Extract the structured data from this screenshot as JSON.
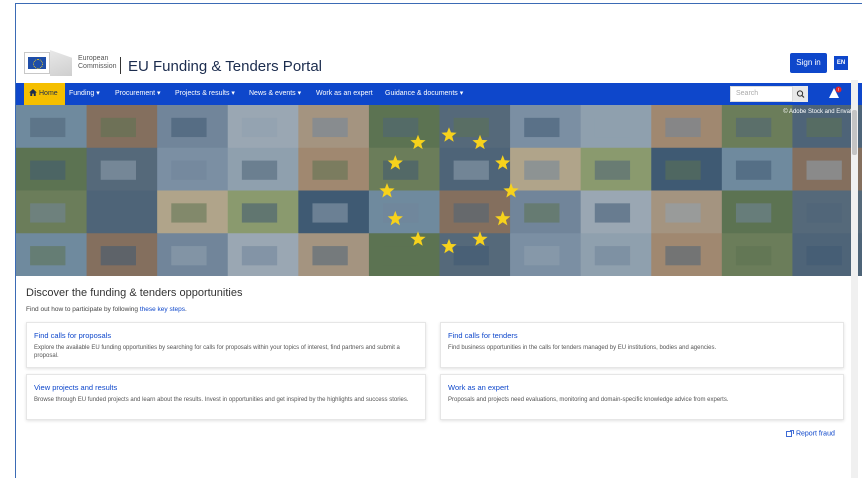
{
  "header": {
    "logo_line1": "European",
    "logo_line2": "Commission",
    "portal_title": "EU Funding & Tenders Portal",
    "signin_label": "Sign in",
    "lang_label": "EN"
  },
  "nav": {
    "items": [
      {
        "label": "Home"
      },
      {
        "label": "Funding ▾"
      },
      {
        "label": "Procurement ▾"
      },
      {
        "label": "Projects & results ▾"
      },
      {
        "label": "News & events ▾"
      },
      {
        "label": "Work as an expert"
      },
      {
        "label": "Guidance & documents ▾"
      }
    ],
    "search_placeholder": "Search"
  },
  "hero": {
    "credit": "© Adobe Stock and Envato"
  },
  "discover": {
    "title": "Discover the funding & tenders opportunities",
    "sub_prefix": "Find out how to participate by following ",
    "sub_link": "these key steps",
    "sub_suffix": "."
  },
  "cards": [
    {
      "title": "Find calls for proposals",
      "desc": "Explore the available EU funding opportunities by searching for calls for proposals within your topics of interest, find partners and submit a proposal."
    },
    {
      "title": "Find calls for tenders",
      "desc": "Find business opportunities in the calls for tenders managed by EU institutions, bodies and agencies."
    },
    {
      "title": "View projects and results",
      "desc": "Browse through EU funded projects and learn about the results. Invest in opportunities and get inspired by the highlights and success stories."
    },
    {
      "title": "Work as an expert",
      "desc": "Proposals and projects need evaluations, monitoring and domain-specific knowledge advice from experts."
    }
  ],
  "footer": {
    "report_label": "Report fraud"
  },
  "colors": {
    "brand_blue": "#0e47cb",
    "home_yellow": "#f5bf00",
    "star_yellow": "#f7d21c"
  }
}
